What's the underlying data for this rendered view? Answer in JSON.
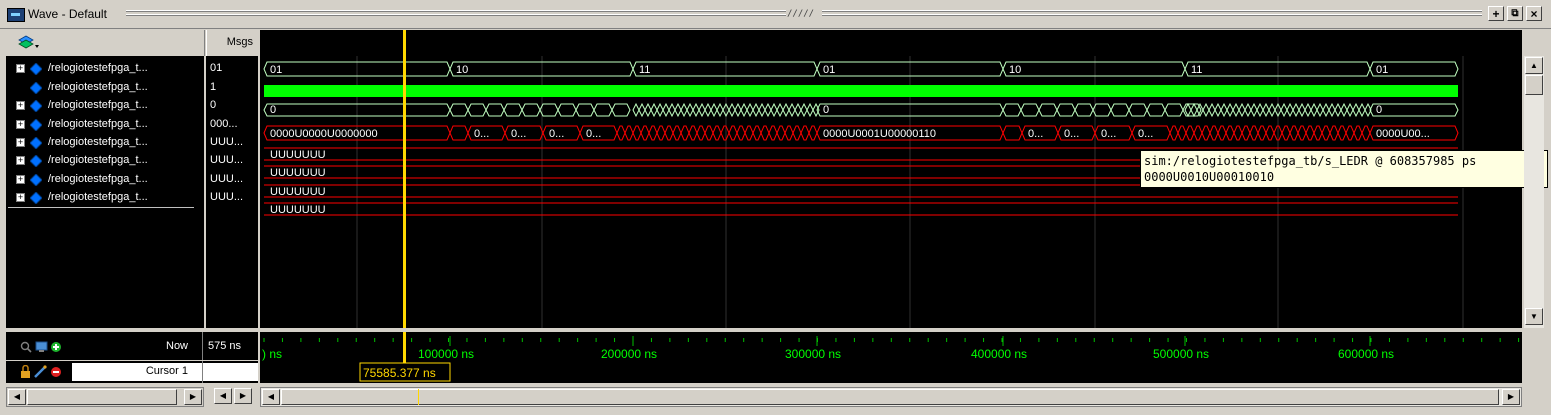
{
  "window": {
    "title": "Wave - Default",
    "center_grip": "/////",
    "buttons": {
      "dock": "+",
      "float": "⧉",
      "close": "×"
    }
  },
  "header": {
    "msgs_label": "Msgs"
  },
  "signals": [
    {
      "name": "/relogiotestefpga_t...",
      "value": "01",
      "expandable": true,
      "color": "#0070ff"
    },
    {
      "name": "/relogiotestefpga_t...",
      "value": "1",
      "expandable": false,
      "color": "#0070ff"
    },
    {
      "name": "/relogiotestefpga_t...",
      "value": "0",
      "expandable": true,
      "color": "#0070ff"
    },
    {
      "name": "/relogiotestefpga_t...",
      "value": "000...",
      "expandable": true,
      "color": "#0070ff"
    },
    {
      "name": "/relogiotestefpga_t...",
      "value": "UUU...",
      "expandable": true,
      "color": "#0070ff"
    },
    {
      "name": "/relogiotestefpga_t...",
      "value": "UUU...",
      "expandable": true,
      "color": "#0070ff"
    },
    {
      "name": "/relogiotestefpga_t...",
      "value": "UUU...",
      "expandable": true,
      "color": "#0070ff"
    },
    {
      "name": "/relogiotestefpga_t...",
      "value": "UUU...",
      "expandable": true,
      "color": "#0070ff"
    }
  ],
  "waves": {
    "row0_labels": [
      "01",
      "10",
      "11",
      "01",
      "10",
      "11",
      "01"
    ],
    "row2_labels": [
      "0",
      "0",
      "0"
    ],
    "row3_labels": [
      "0000U0000U0000000",
      "0...",
      "0...",
      "0...",
      "0...",
      "0000U0001U00000110",
      "0...",
      "0...",
      "0...",
      "0...",
      "0000U00..."
    ],
    "row4_label": "UUUUUUU",
    "row5_label": "UUUUUUU",
    "row6_label": "UUUUUUU",
    "row7_label": "UUUUUUU",
    "colors": {
      "green": "#00ff00",
      "red": "#ff0000",
      "light": "#c0ffc0",
      "cursor": "#ffd700",
      "grid": "#303030"
    }
  },
  "tooltip": {
    "line1": "sim:/relogiotestefpga_tb/s_LEDR @ 608357985 ps",
    "line2": "0000U0010U00010010"
  },
  "timeline": {
    "now_label": "Now",
    "now_value": "575 ns",
    "cursor_label": "Cursor 1",
    "cursor_value": "377 ns",
    "cursor_time": "75585.377 ns",
    "start_label": ") ns",
    "ticks": [
      "100000 ns",
      "200000 ns",
      "300000 ns",
      "400000 ns",
      "500000 ns",
      "600000 ns"
    ]
  },
  "icons": {
    "toolbar": "layers-icon",
    "now_icons": [
      "zoom-icon",
      "monitor-icon",
      "add-icon"
    ],
    "cursor_icons": [
      "lock-icon",
      "edit-icon",
      "remove-icon"
    ]
  }
}
